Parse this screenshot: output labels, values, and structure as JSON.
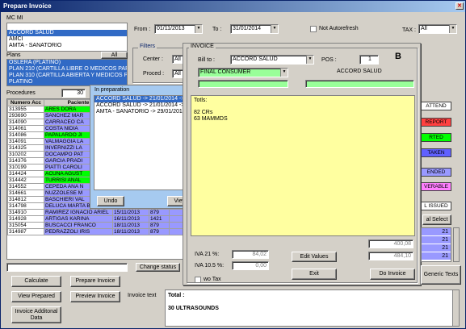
{
  "window": {
    "title": "Prepare Invoice"
  },
  "mcmi": {
    "label": "MC MI",
    "items": [
      "",
      "ACCORD SALUD",
      "AMCI",
      "AMTA - SANATORIO"
    ],
    "selected_index": 1
  },
  "plans": {
    "label": "Plans",
    "all_button": "All",
    "items": [
      "OSLERA (PLATINO)",
      "PLAN 210 (CARTILLA LIBRE O MEDICOS PAR",
      "PLAN 310 (CARTILLA ABIERTA Y MEDICOS PA",
      "PLATINO"
    ]
  },
  "dates": {
    "from_label": "From :",
    "from_value": "01/11/2013",
    "to_label": "To :",
    "to_value": "31/01/2014"
  },
  "not_autorefresh": {
    "label": "Not Autorefresh"
  },
  "tax": {
    "label": "TAX :",
    "value": "All"
  },
  "filters": {
    "title": "Filters",
    "center_label": "Center :",
    "center_value": "All",
    "proced_label": "Proced :",
    "proced_value": "All"
  },
  "procedures": {
    "label": "Procedures",
    "count": "30",
    "columns": [
      "Numero Acc",
      "Paciente",
      "",
      ""
    ],
    "rows": [
      {
        "num": "313955",
        "name": "ARES DORA",
        "date": "",
        "code": "",
        "color": "#00ff00"
      },
      {
        "num": "293690",
        "name": "SANCHEZ MAR",
        "date": "",
        "code": "",
        "color": "#9999ff"
      },
      {
        "num": "314090",
        "name": "CARRACEO CA",
        "date": "",
        "code": "",
        "color": "#9999ff"
      },
      {
        "num": "314061",
        "name": "COSTA NIDIA",
        "date": "",
        "code": "",
        "color": "#9999ff"
      },
      {
        "num": "314086",
        "name": "PAPALARDO JI",
        "date": "",
        "code": "",
        "color": "#00ff00"
      },
      {
        "num": "314091",
        "name": "VALMAGGIA LA",
        "date": "",
        "code": "",
        "color": "#9999ff"
      },
      {
        "num": "314325",
        "name": "INVERNIZZI LA",
        "date": "",
        "code": "",
        "color": "#9999ff"
      },
      {
        "num": "310202",
        "name": "DOCAMPO PAT",
        "date": "",
        "code": "",
        "color": "#9999ff"
      },
      {
        "num": "314376",
        "name": "GARCIA PRADI",
        "date": "",
        "code": "",
        "color": "#9999ff"
      },
      {
        "num": "310199",
        "name": "PIATTI CAROLI",
        "date": "",
        "code": "",
        "color": "#9999ff"
      },
      {
        "num": "314424",
        "name": "ACUÑA AGUST",
        "date": "",
        "code": "",
        "color": "#00ff00"
      },
      {
        "num": "314442",
        "name": "TURRISI ANAL",
        "date": "",
        "code": "",
        "color": "#00ff00"
      },
      {
        "num": "314552",
        "name": "CEPEDA ANA N",
        "date": "",
        "code": "",
        "color": "#9999ff"
      },
      {
        "num": "314661",
        "name": "NUZZOLESE M",
        "date": "",
        "code": "",
        "color": "#9999ff"
      },
      {
        "num": "314812",
        "name": "BASCHIERI VAL",
        "date": "",
        "code": "",
        "color": "#9999ff"
      },
      {
        "num": "314798",
        "name": "DELUCA MARTA BIBIANA",
        "date": "14/11/2013",
        "code": "879",
        "color": "#9999ff"
      },
      {
        "num": "314910",
        "name": "RAMIREZ IGNACIO ARIEL",
        "date": "15/11/2013",
        "code": "879",
        "color": "#9999ff"
      },
      {
        "num": "314928",
        "name": "ARTIGAS KARINA",
        "date": "16/11/2013",
        "code": "1421",
        "color": "#9999ff"
      },
      {
        "num": "315054",
        "name": "BUSCACCI FRANCO",
        "date": "18/11/2013",
        "code": "879",
        "color": "#9999ff"
      },
      {
        "num": "314987",
        "name": "PEDRAZZOLI IRIS",
        "date": "18/11/2013",
        "code": "879",
        "color": "#9999ff"
      }
    ]
  },
  "in_preparation": {
    "title": "In preparation",
    "items": [
      "ACCORD SALUD -> 21/01/2014 -> 8",
      "ACCORD SALUD -> 21/01/2014 -> 8",
      "AMTA - SANATORIO -> 29/01/2014 ->"
    ],
    "undo": "Undo",
    "view": "View"
  },
  "invoice": {
    "title": "INVOICE",
    "billto_label": "Bill to :",
    "billto_value": "ACCORD SALUD",
    "pos_label": "POS :",
    "pos_value": "1",
    "letter": "B",
    "consumer_value": "FINAL CONSUMER",
    "name_label": "ACCORD SALUD",
    "totls_label": "Totls:",
    "totls_lines": [
      "82 CRs",
      "63 MAMMDS"
    ],
    "subtotal": "400,08",
    "iva21_label": "IVA 21 %:",
    "iva21_value": "84,02",
    "iva105_label": "IVA 10.5 %:",
    "iva105_value": "0,00",
    "total_value": "484,10",
    "wotax_label": "wo Tax",
    "edit_values": "Edit Values",
    "exit": "Exit",
    "do_invoice": "Do Invoice"
  },
  "status_pills": [
    {
      "label": "ATTEND",
      "color": "#ffffff"
    },
    {
      "label": "REPORT",
      "color": "#ff4040"
    },
    {
      "label": "RTED",
      "color": "#00ff00"
    },
    {
      "label": "TAKEN",
      "color": "#6060ff"
    },
    {
      "label": "ENDED",
      "color": "#9999ff"
    },
    {
      "label": "VERABLE",
      "color": "#ff80ff"
    },
    {
      "label": "L ISSUED",
      "color": "#ffffff"
    }
  ],
  "right_panel": {
    "select_button": "al Select",
    "values": [
      "21",
      "21",
      "21",
      "21"
    ],
    "generic_texts": "Generic Texts"
  },
  "bottom": {
    "change_status": "Change status",
    "calculate": "Calculate",
    "prepare_invoice": "Prepare Invoice",
    "view_prepared": "View Prepared",
    "preview_invoice": "Preview Invoice",
    "invoice_additional": "Invoice Additonal Data",
    "invoice_text_label": "Invoice text",
    "total_label": "Total :",
    "total_line": "30 ULTRASOUNDS"
  }
}
